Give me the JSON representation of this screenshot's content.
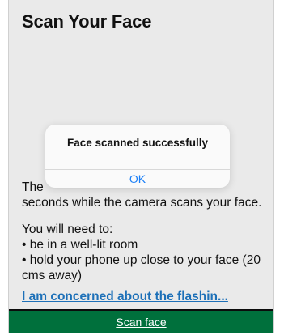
{
  "screen": {
    "title": "Scan Your Face",
    "intro_fragment": "The",
    "intro_rest": "seconds while the camera scans your face.",
    "needs_heading": "You will need to:",
    "needs": [
      "• be in a well-lit room",
      "• hold your phone up close to your face (20 cms away)"
    ],
    "concern_link": "I am concerned about the flashin...",
    "scan_button": "Scan face"
  },
  "alert": {
    "message": "Face scanned successfully",
    "ok_label": "OK"
  },
  "colors": {
    "link": "#1d70b8",
    "button_bg": "#00703c",
    "alert_ok": "#1a7ff7"
  }
}
